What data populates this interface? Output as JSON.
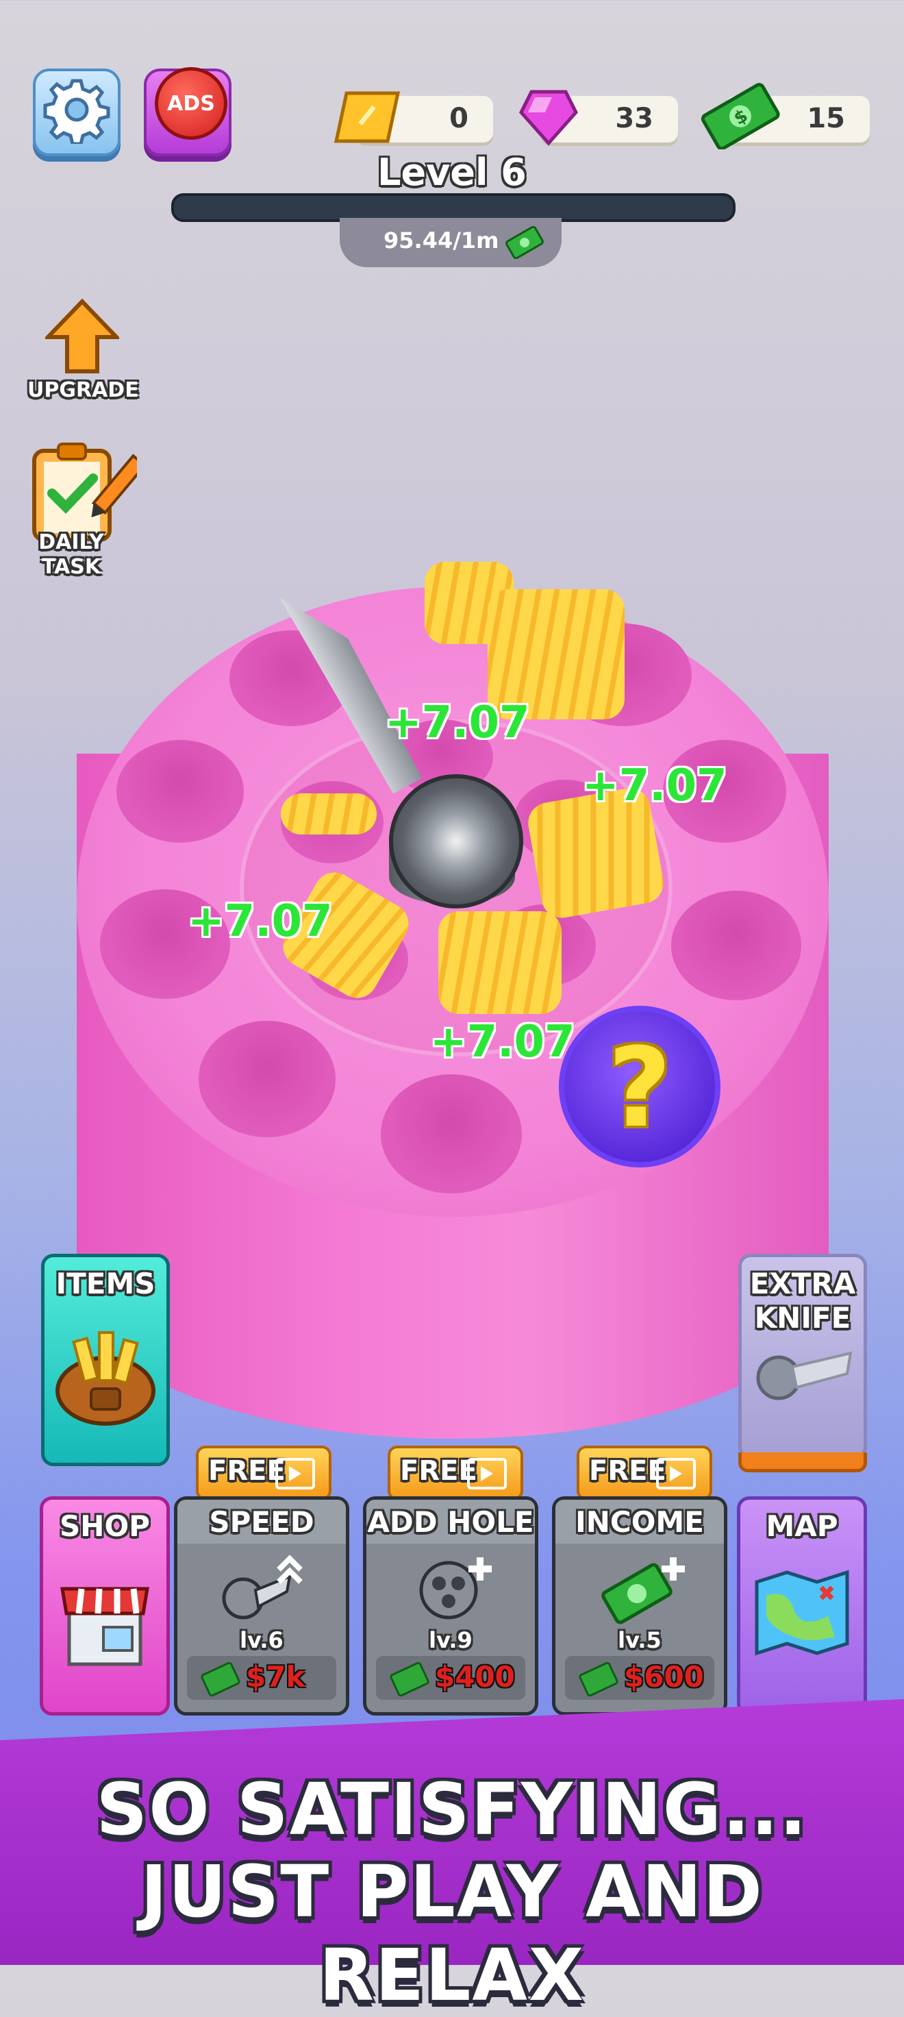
{
  "hud": {
    "settings_icon": "gear-icon",
    "ads_label": "ADS",
    "currencies": [
      {
        "name": "ticket",
        "icon": "ticket-icon",
        "value": "0"
      },
      {
        "name": "gem",
        "icon": "gem-icon",
        "value": "33"
      },
      {
        "name": "cash",
        "icon": "cash-icon",
        "value": "15"
      }
    ],
    "level_label": "Level 6",
    "level_progress": 0.0,
    "income_rate": "95.44/1m"
  },
  "side": {
    "upgrade_label": "UPGRADE",
    "daily_task_label": "DAILY TASK"
  },
  "board": {
    "floating_rewards": [
      "+7.07",
      "+7.07",
      "+7.07",
      "+7.07"
    ],
    "mystery_label": "?"
  },
  "cards": {
    "items_label": "ITEMS",
    "extra_knife_label": "EXTRA KNIFE",
    "shop_label": "SHOP",
    "map_label": "MAP",
    "free_label": "FREE",
    "upgrades": [
      {
        "name": "speed",
        "label": "SPEED",
        "level": "lv.6",
        "price": "$7k"
      },
      {
        "name": "add-hole",
        "label": "ADD HOLE",
        "level": "lv.9",
        "price": "$400"
      },
      {
        "name": "income",
        "label": "INCOME",
        "level": "lv.5",
        "price": "$600"
      }
    ]
  },
  "banner": {
    "line1": "SO SATISFYING...",
    "line2": "JUST PLAY AND RELAX"
  },
  "colors": {
    "accent_green": "#2be637",
    "price_red": "#e0201c",
    "cylinder_pink": "#f383d6",
    "banner_purple": "#b43bd8"
  }
}
